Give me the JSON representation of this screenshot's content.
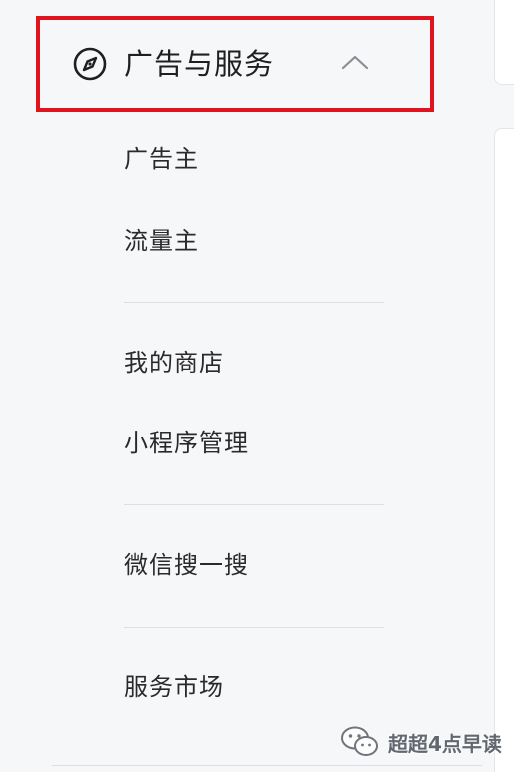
{
  "section": {
    "title": "广告与服务",
    "icon": "compass-icon",
    "expand_icon": "chevron-up-icon",
    "highlight_color": "#e0141e"
  },
  "menu": {
    "groups": [
      {
        "items": [
          "广告主",
          "流量主"
        ]
      },
      {
        "items": [
          "我的商店",
          "小程序管理"
        ]
      },
      {
        "items": [
          "微信搜一搜"
        ]
      },
      {
        "items": [
          "服务市场"
        ]
      }
    ]
  },
  "watermark": {
    "icon": "wechat-logo-icon",
    "text": "超超4点早读"
  }
}
